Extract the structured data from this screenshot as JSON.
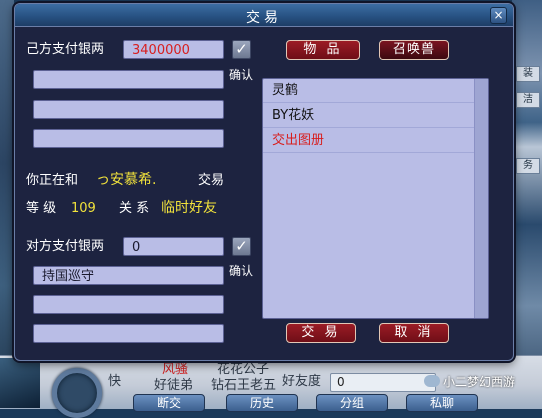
{
  "window": {
    "title": "交易",
    "close": "×"
  },
  "self_side": {
    "pay_label": "己方支付银两",
    "silver": "3400000",
    "confirm_label": "确认",
    "item_slots": [
      "",
      "",
      ""
    ]
  },
  "partner": {
    "trading_prefix": "你正在和",
    "name": "っ安慕希.",
    "trading_suffix": "交易",
    "level_label": "等 级",
    "level": "109",
    "relation_label": "关 系",
    "relation": "临时好友"
  },
  "other_side": {
    "pay_label": "对方支付银两",
    "silver": "0",
    "confirm_label": "确认",
    "item_slots": [
      "持国巡守",
      "",
      ""
    ]
  },
  "tabs": {
    "items": "物 品",
    "summon": "召唤兽"
  },
  "item_list": [
    {
      "label": "灵鹤",
      "color": "#111111"
    },
    {
      "label": "BY花妖",
      "color": "#111111"
    },
    {
      "label": "交出图册",
      "color": "#d81e1e"
    }
  ],
  "actions": {
    "trade": "交 易",
    "cancel": "取 消"
  },
  "background": {
    "bottom_labels": [
      "快",
      "风骚",
      "好徒弟",
      "花花公子",
      "钻石王老五",
      "好友度"
    ],
    "friendship_value": "0",
    "bottom_buttons": [
      "断交",
      "历史",
      "分组",
      "私聊"
    ],
    "watermark": "小二梦幻西游",
    "right_strip": [
      "装",
      "洁",
      "务"
    ],
    "left_strip": "强"
  }
}
